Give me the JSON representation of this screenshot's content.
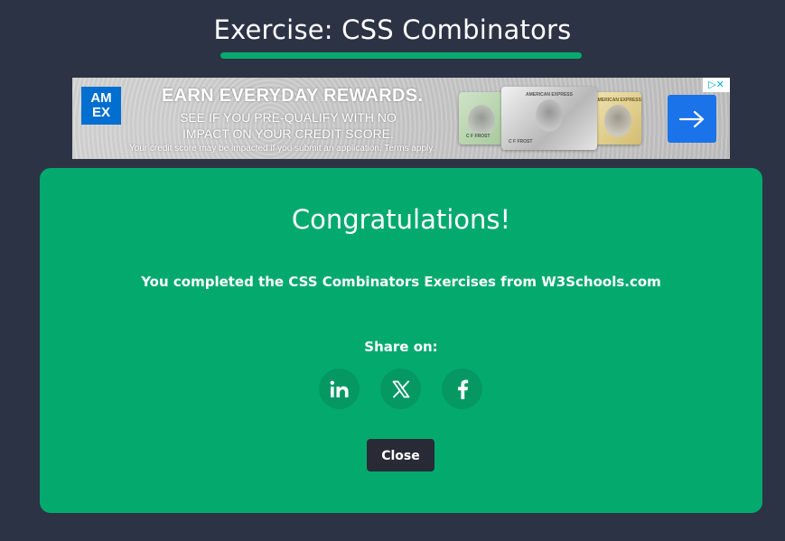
{
  "header": {
    "title": "Exercise: CSS Combinators"
  },
  "ad": {
    "logo_text": "AM EX",
    "headline": "EARN EVERYDAY REWARDS.",
    "subline": "SEE IF YOU PRE-QUALIFY WITH NO IMPACT ON YOUR CREDIT SCORE.",
    "fine_print": "Your credit score may be impacted if you submit an application. Terms apply.",
    "card_brand": "AMERICAN EXPRESS",
    "card_holder": "C F FROST",
    "choices_label": "▷✕"
  },
  "modal": {
    "heading": "Congratulations!",
    "message": "You completed the CSS Combinators Exercises from W3Schools.com",
    "share_label": "Share on:",
    "close_label": "Close"
  },
  "share_buttons": [
    {
      "icon": "linkedin-icon"
    },
    {
      "icon": "x-icon"
    },
    {
      "icon": "facebook-icon"
    }
  ],
  "colors": {
    "background": "#2c3345",
    "accent_green": "#04aa6d",
    "share_circle": "#059862",
    "close_button": "#282a35",
    "ad_arrow": "#1a73e8",
    "amex_blue": "#016fd0"
  }
}
